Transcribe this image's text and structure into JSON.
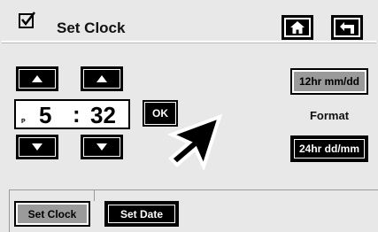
{
  "header": {
    "title": "Set Clock",
    "checkbox_icon": "checkbox-checked-icon",
    "home_icon": "home-icon",
    "back_icon": "return-arrow-icon"
  },
  "clock": {
    "am_pm": "P",
    "hour": "5",
    "separator": ":",
    "minute": "32"
  },
  "buttons": {
    "ok_label": "OK"
  },
  "format": {
    "label": "Format",
    "option_1": "12hr mm/dd",
    "option_2": "24hr dd/mm",
    "selected": "12hr mm/dd"
  },
  "tabs": [
    {
      "label": "Set Clock",
      "active": true
    },
    {
      "label": "Set Date",
      "active": false
    }
  ],
  "colors": {
    "background": "#e8e8e8",
    "button_dark": "#000000",
    "button_selected": "#9a9a9a"
  }
}
